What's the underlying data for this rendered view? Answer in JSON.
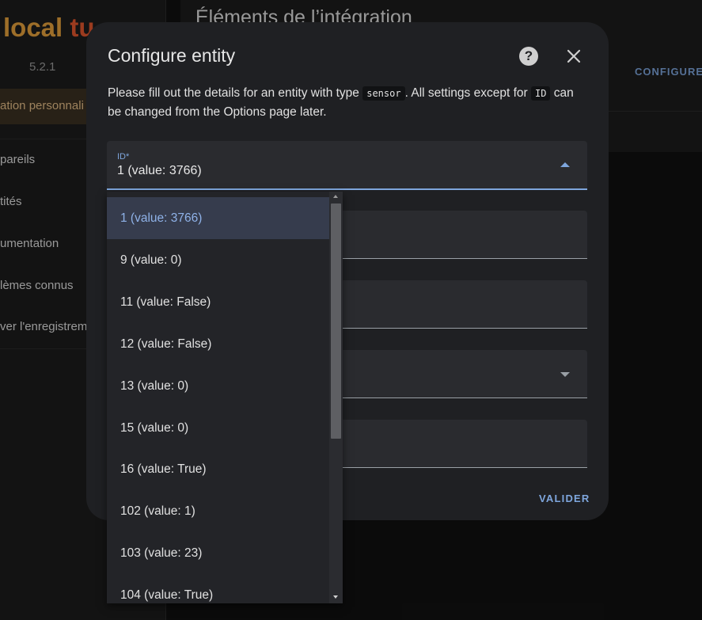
{
  "background": {
    "brand_main": "local ",
    "brand_tail": "tu",
    "version": "5.2.1",
    "sidebar_active": "ation personnali",
    "sidebar_items": [
      "pareils",
      "tités",
      "umentation",
      "lèmes connus",
      "ver l'enregistrem"
    ],
    "card_title": "Éléments de l’intégration",
    "configure_label": "CONFIGURE"
  },
  "dialog": {
    "title": "Configure entity",
    "desc_part1": "Please fill out the details for an entity with type ",
    "desc_code1": "sensor",
    "desc_part2": ". All settings except for ",
    "desc_code2": "ID",
    "desc_part3": " can be changed from the Options page later.",
    "id_field": {
      "label": "ID*",
      "value": "1 (value: 3766)"
    },
    "submit_label": "VALIDER"
  },
  "dropdown": {
    "options": [
      "1 (value: 3766)",
      "9 (value: 0)",
      "11 (value: False)",
      "12 (value: False)",
      "13 (value: 0)",
      "15 (value: 0)",
      "16 (value: True)",
      "102 (value: 1)",
      "103 (value: 23)",
      "104 (value: True)"
    ],
    "selected_index": 0
  },
  "colors": {
    "accent": "#7ea6dd",
    "brand_orange": "#e8a33d",
    "brand_red": "#e5572f",
    "dialog_bg": "#1f2023"
  }
}
